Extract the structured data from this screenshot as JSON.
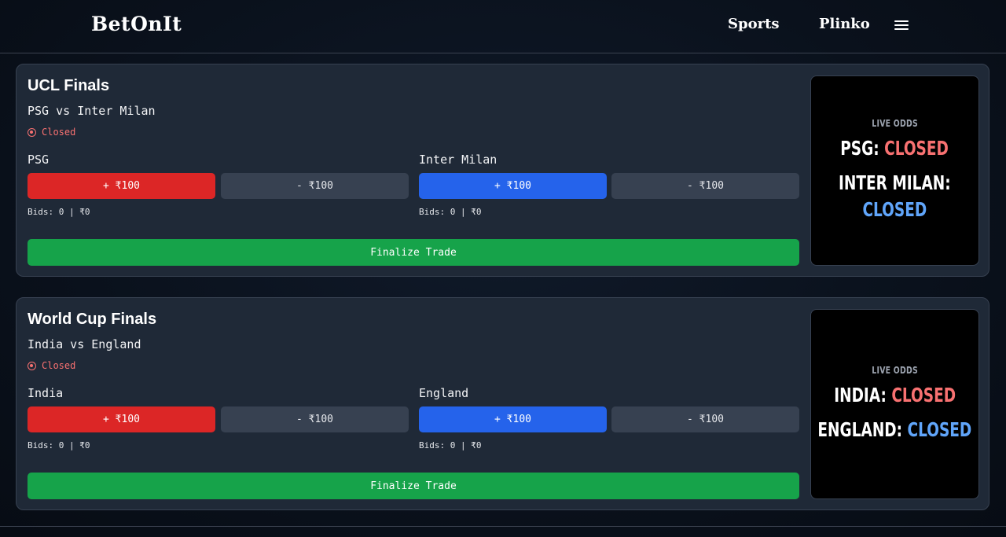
{
  "nav": {
    "brand": "BetOnIt",
    "links": [
      "Sports",
      "Plinko"
    ],
    "menu_icon": "hamburger-menu-icon"
  },
  "colors": {
    "background": "#0a111c",
    "card": "#1f2937",
    "team_a_button": "#dc2626",
    "team_b_button": "#2563eb",
    "minus_button": "#374151",
    "finalize_button": "#16a34a",
    "closed_status": "#f87171",
    "odds_team_b": "#60a5fa"
  },
  "markets": [
    {
      "title": "UCL Finals",
      "match": "PSG vs Inter Milan",
      "status": "Closed",
      "team_a": {
        "name": "PSG",
        "plus": "+ ₹100",
        "minus": "- ₹100",
        "bids": "Bids: 0 | ₹0"
      },
      "team_b": {
        "name": "Inter Milan",
        "plus": "+ ₹100",
        "minus": "- ₹100",
        "bids": "Bids: 0 | ₹0"
      },
      "finalize": "Finalize Trade",
      "odds": {
        "label": "LIVE ODDS",
        "team_a_label": "PSG:",
        "team_a_value": "CLOSED",
        "team_b_label": "INTER MILAN:",
        "team_b_value": "CLOSED"
      }
    },
    {
      "title": "World Cup Finals",
      "match": "India vs England",
      "status": "Closed",
      "team_a": {
        "name": "India",
        "plus": "+ ₹100",
        "minus": "- ₹100",
        "bids": "Bids: 0 | ₹0"
      },
      "team_b": {
        "name": "England",
        "plus": "+ ₹100",
        "minus": "- ₹100",
        "bids": "Bids: 0 | ₹0"
      },
      "finalize": "Finalize Trade",
      "odds": {
        "label": "LIVE ODDS",
        "team_a_label": "INDIA:",
        "team_a_value": "CLOSED",
        "team_b_label": "ENGLAND:",
        "team_b_value": "CLOSED"
      }
    }
  ]
}
